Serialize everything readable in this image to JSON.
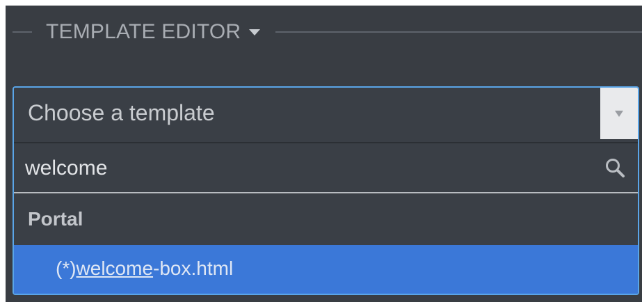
{
  "section": {
    "title": "TEMPLATE EDITOR"
  },
  "combo": {
    "placeholder": "Choose a template",
    "search_value": "welcome",
    "group": "Portal",
    "option": {
      "prefix": "(*)",
      "match": "welcome",
      "suffix": "-box.html"
    }
  },
  "colors": {
    "background": "#393d43",
    "focus_border": "#5aa5e8",
    "highlight": "#3b78d8"
  },
  "icons": {
    "header_caret": "caret-down-icon",
    "select_arrow": "triangle-down-icon",
    "search": "search-icon"
  }
}
